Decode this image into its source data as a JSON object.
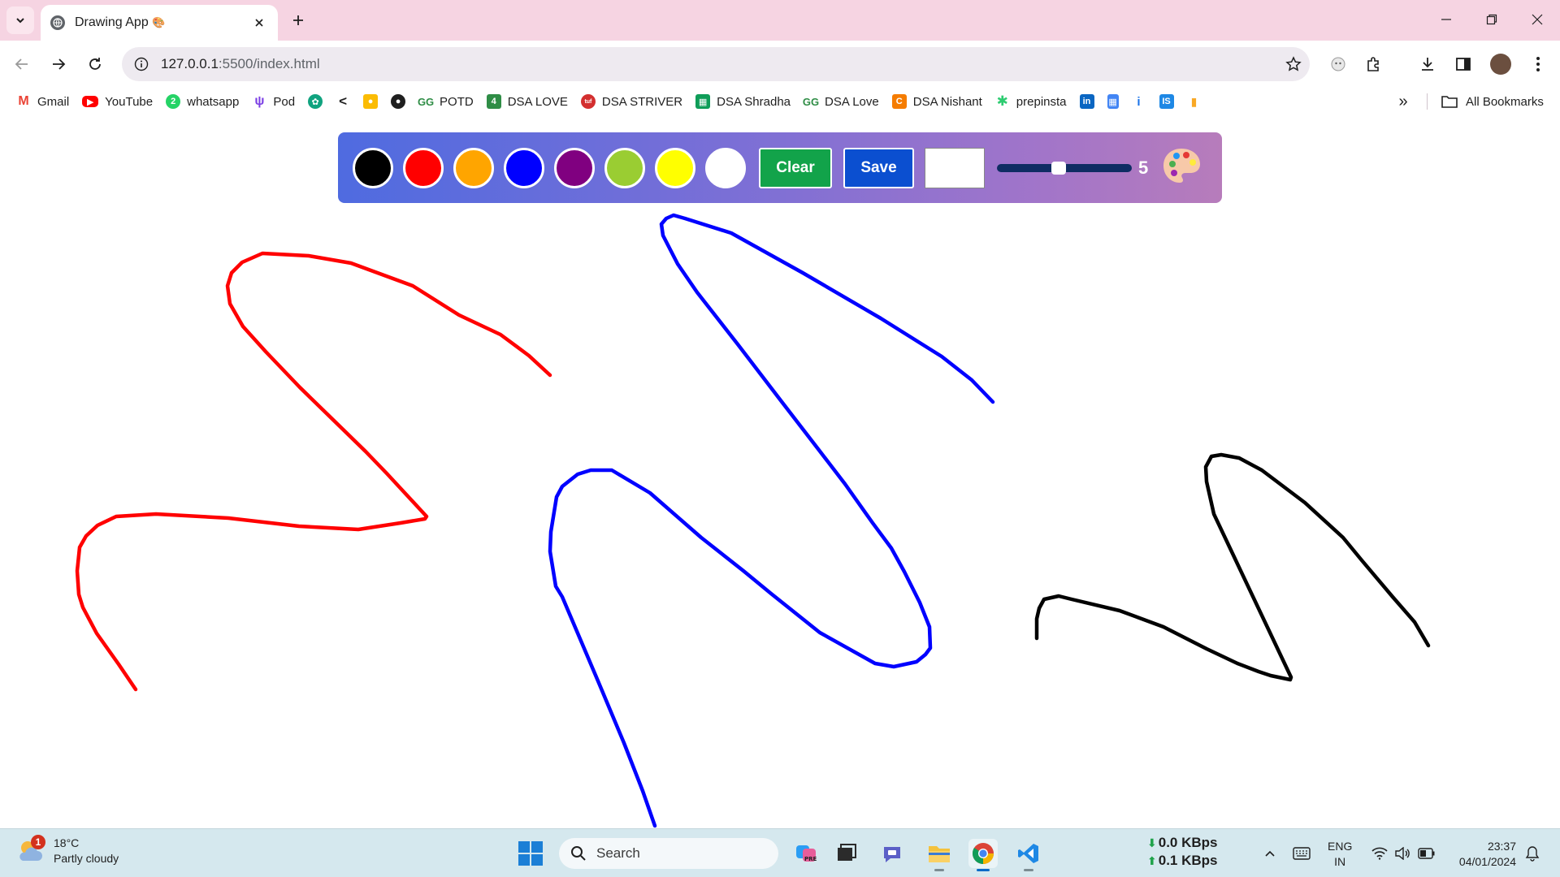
{
  "browser": {
    "tab_title": "Drawing App",
    "url_host": "127.0.0.1",
    "url_rest": ":5500/index.html"
  },
  "bookmarks": {
    "items": [
      {
        "label": "Gmail",
        "icon": "gmail-icon",
        "color": "#ea4335"
      },
      {
        "label": "YouTube",
        "icon": "youtube-icon",
        "color": "#ff0000"
      },
      {
        "label": "whatsapp",
        "icon": "whatsapp-icon",
        "color": "#25d366"
      },
      {
        "label": "Pod",
        "icon": "pod-icon",
        "color": "#7b3fe4"
      },
      {
        "label": "",
        "icon": "chatgpt-icon",
        "color": "#10a37f"
      },
      {
        "label": "",
        "icon": "leetcode-icon",
        "color": "#f89f1b"
      },
      {
        "label": "",
        "icon": "keep-icon",
        "color": "#fbbc04"
      },
      {
        "label": "",
        "icon": "github-icon",
        "color": "#1f1f1f"
      },
      {
        "label": "POTD",
        "icon": "gfg-icon",
        "color": "#2f8d46"
      },
      {
        "label": "DSA LOVE",
        "icon": "sheet-4-icon",
        "color": "#2f8d46"
      },
      {
        "label": "DSA STRIVER",
        "icon": "tuf-icon",
        "color": "#d32f2f"
      },
      {
        "label": "DSA Shradha",
        "icon": "sheets-icon",
        "color": "#0f9d58"
      },
      {
        "label": "DSA Love",
        "icon": "gfg-icon",
        "color": "#2f8d46"
      },
      {
        "label": "DSA Nishant",
        "icon": "nishant-icon",
        "color": "#f57c00"
      },
      {
        "label": "prepinsta",
        "icon": "prepinsta-icon",
        "color": "#2ecc71"
      },
      {
        "label": "",
        "icon": "linkedin-icon",
        "color": "#0a66c2"
      },
      {
        "label": "",
        "icon": "doc-icon",
        "color": "#4285f4"
      },
      {
        "label": "",
        "icon": "info-icon",
        "color": "#1a73e8"
      },
      {
        "label": "",
        "icon": "is-icon",
        "color": "#1e88e5"
      },
      {
        "label": "",
        "icon": "beer-icon",
        "color": "#f9a825"
      }
    ],
    "all_bookmarks": "All Bookmarks"
  },
  "app": {
    "colors": [
      {
        "name": "black",
        "hex": "#000000"
      },
      {
        "name": "red",
        "hex": "#ff0000"
      },
      {
        "name": "orange",
        "hex": "#ffa500"
      },
      {
        "name": "blue",
        "hex": "#0000ff"
      },
      {
        "name": "purple",
        "hex": "#800080"
      },
      {
        "name": "yellowgreen",
        "hex": "#9acd32"
      },
      {
        "name": "yellow",
        "hex": "#ffff00"
      },
      {
        "name": "white",
        "hex": "#ffffff"
      }
    ],
    "clear_label": "Clear",
    "save_label": "Save",
    "custom_color": "#ffffff",
    "brush_size": "5",
    "brush_size_fraction": 0.45
  },
  "taskbar": {
    "temperature": "18°C",
    "weather": "Partly cloudy",
    "weather_badge": "1",
    "search_placeholder": "Search",
    "net_down": "0.0 KBps",
    "net_up": "0.1 KBps",
    "lang_1": "ENG",
    "lang_2": "IN",
    "time": "23:37",
    "date": "04/01/2024"
  }
}
